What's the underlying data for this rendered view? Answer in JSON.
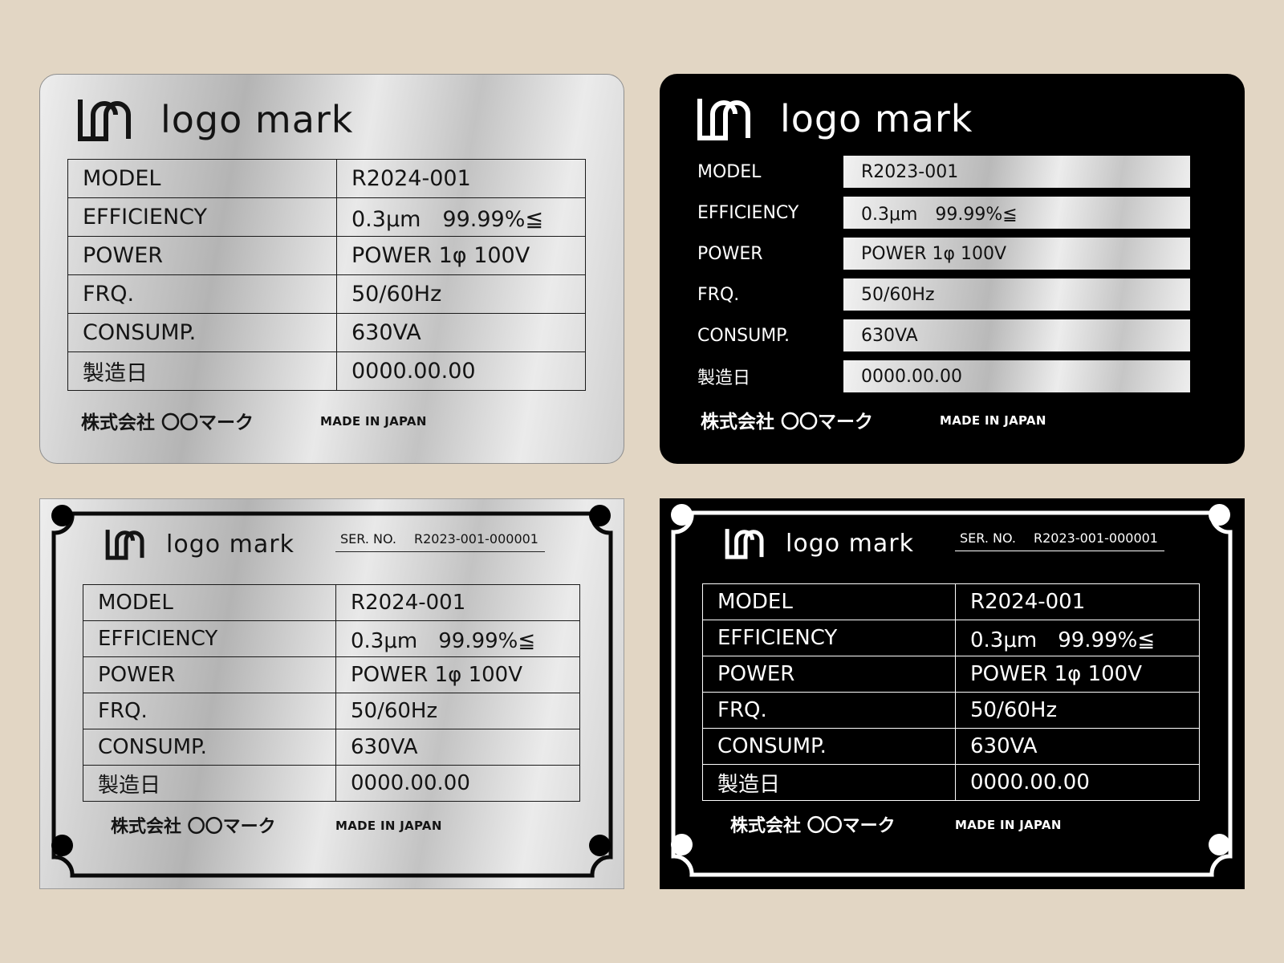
{
  "logo_text": "logo mark",
  "company": "株式会社 〇〇マーク",
  "made_in": "MADE IN JAPAN",
  "serial": {
    "label": "SER. NO.",
    "value": "R2023-001-000001"
  },
  "colors": {
    "background": "#e2d6c4",
    "black_plate": "#000000",
    "silver_plate": "#c8c8c8"
  },
  "plates": [
    {
      "variant": "silver-rounded",
      "rows": [
        {
          "label": "MODEL",
          "value": "R2024-001"
        },
        {
          "label": "EFFICIENCY",
          "value": "0.3μm　99.99%≦"
        },
        {
          "label": "POWER",
          "value": "POWER 1φ 100V"
        },
        {
          "label": "FRQ.",
          "value": "50/60Hz"
        },
        {
          "label": "CONSUMP.",
          "value": "630VA"
        },
        {
          "label": "製造日",
          "value": "0000.00.00"
        }
      ]
    },
    {
      "variant": "black-rounded",
      "rows": [
        {
          "label": "MODEL",
          "value": "R2023-001"
        },
        {
          "label": "EFFICIENCY",
          "value": "0.3μm　99.99%≦"
        },
        {
          "label": "POWER",
          "value": "POWER 1φ 100V"
        },
        {
          "label": "FRQ.",
          "value": "50/60Hz"
        },
        {
          "label": "CONSUMP.",
          "value": "630VA"
        },
        {
          "label": "製造日",
          "value": "0000.00.00"
        }
      ]
    },
    {
      "variant": "silver-framed",
      "rows": [
        {
          "label": "MODEL",
          "value": "R2024-001"
        },
        {
          "label": "EFFICIENCY",
          "value": "0.3μm　99.99%≦"
        },
        {
          "label": "POWER",
          "value": "POWER 1φ 100V"
        },
        {
          "label": "FRQ.",
          "value": "50/60Hz"
        },
        {
          "label": "CONSUMP.",
          "value": "630VA"
        },
        {
          "label": "製造日",
          "value": "0000.00.00"
        }
      ]
    },
    {
      "variant": "black-framed",
      "rows": [
        {
          "label": "MODEL",
          "value": "R2024-001"
        },
        {
          "label": "EFFICIENCY",
          "value": "0.3μm　99.99%≦"
        },
        {
          "label": "POWER",
          "value": "POWER 1φ 100V"
        },
        {
          "label": "FRQ.",
          "value": "50/60Hz"
        },
        {
          "label": "CONSUMP.",
          "value": "630VA"
        },
        {
          "label": "製造日",
          "value": "0000.00.00"
        }
      ]
    }
  ]
}
